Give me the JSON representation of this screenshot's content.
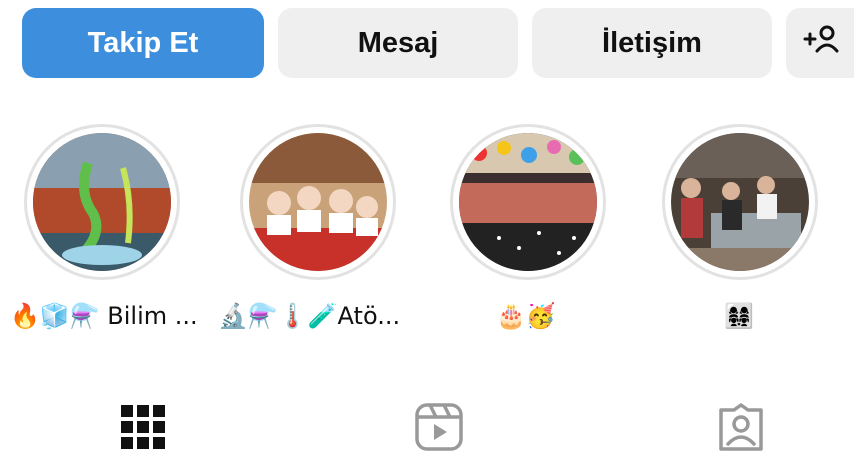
{
  "actions": {
    "follow_label": "Takip Et",
    "message_label": "Mesaj",
    "contact_label": "İletişim",
    "add_user_label": "+웃"
  },
  "highlights": [
    {
      "label": "🔥🧊⚗️ Bilim ...",
      "icon": "science-fair-photo"
    },
    {
      "label": "🔬⚗️🌡️🧪Atö...",
      "icon": "lab-kids-photo"
    },
    {
      "label": "🎂🥳",
      "icon": "party-photo"
    },
    {
      "label": "👩‍👩‍👧‍👧",
      "icon": "museum-visit-photo"
    }
  ],
  "tabs": [
    {
      "name": "grid-icon",
      "active": true
    },
    {
      "name": "reels-icon",
      "active": false
    },
    {
      "name": "tagged-icon",
      "active": false
    }
  ],
  "colors": {
    "accent": "#3d8fdd",
    "button_bg": "#efefef",
    "ring": "#e2e2e2"
  }
}
